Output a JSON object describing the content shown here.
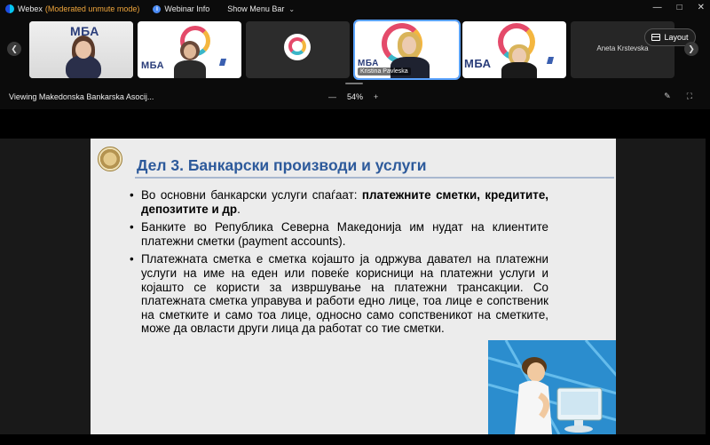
{
  "app": {
    "name": "Webex",
    "mode": "(Moderated unmute mode)",
    "webinar_info": "Webinar Info",
    "show_menu_bar": "Show Menu Bar"
  },
  "participants": [
    {
      "name": "",
      "tile": "video"
    },
    {
      "name": "",
      "tile": "video"
    },
    {
      "name": "",
      "tile": "video"
    },
    {
      "name": "Kristina Pavleska",
      "tile": "video",
      "active": true
    },
    {
      "name": "",
      "tile": "video"
    },
    {
      "name": "Aneta Krstevska",
      "tile": "no-video"
    }
  ],
  "tile_logos": {
    "mba": "МБА"
  },
  "layout_button": "Layout",
  "viewing": {
    "label": "Viewing Makedonska Bankarska Asocij...",
    "zoom": "54%"
  },
  "slide": {
    "title": "Дел 3. Банкарски производи и услуги",
    "bullets": [
      {
        "pre": "Во основни банкарски услуги спаѓаат: ",
        "bold": "платежните сметки, кредитите, депозитите и др",
        "post": "."
      },
      {
        "pre": "Банките во Република Северна Македонија им нудат на клиентите платежни сметки (payment accounts).",
        "bold": "",
        "post": ""
      },
      {
        "pre": "Платежната сметка е сметка којашто ја одржува давател на платежни услуги на име на еден или повеќе корисници на платежни услуги и којашто се користи за извршување на платежни трансакции. Со платежната сметка управува и работи едно лице, тоа лице е сопственик на сметките и само тоа лице, односно само сопственикот на сметките, може да овласти други лица да работат со тие сметки.",
        "bold": "",
        "post": ""
      }
    ]
  },
  "colors": {
    "accent": "#5aa3ff",
    "title_blue": "#2d5a9b",
    "mode_orange": "#f0a63c"
  },
  "icons": [
    "webex-logo-icon",
    "info-icon",
    "chevron-down-icon",
    "minimize-icon",
    "maximize-icon",
    "close-icon",
    "chevron-left-icon",
    "chevron-right-icon",
    "layout-icon",
    "zoom-out-icon",
    "zoom-in-icon",
    "annotate-icon",
    "fullscreen-icon"
  ]
}
